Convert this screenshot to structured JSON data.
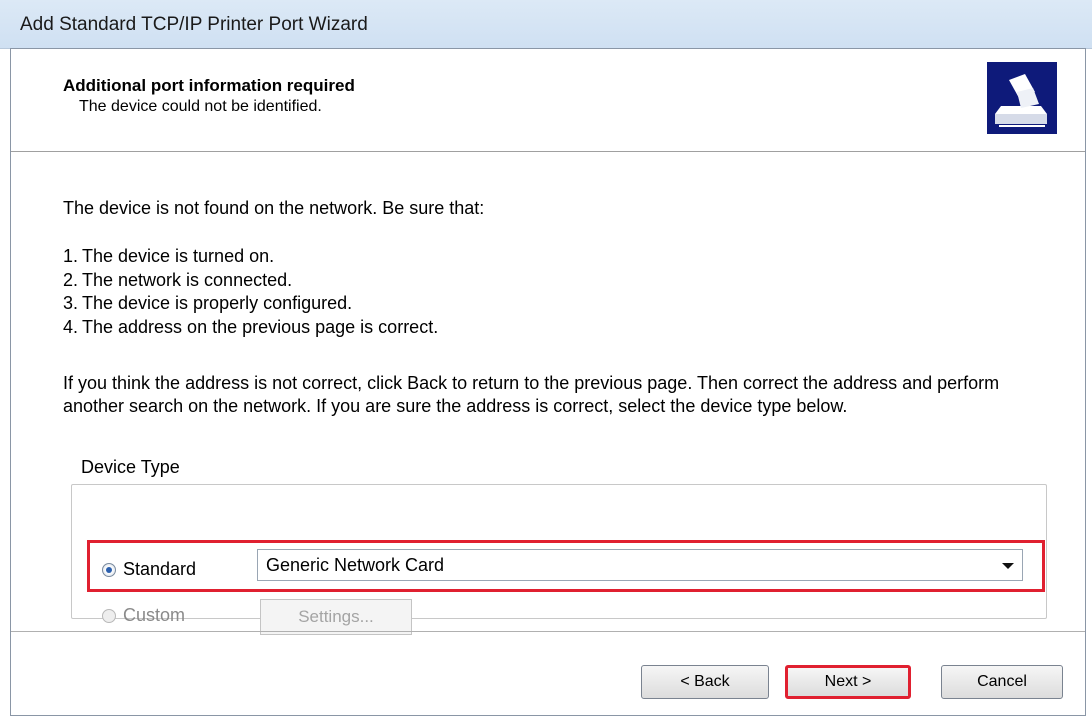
{
  "window": {
    "title": "Add Standard TCP/IP Printer Port Wizard"
  },
  "header": {
    "title": "Additional port information required",
    "subtitle": "The device could not be identified.",
    "icon": "printer-network-icon"
  },
  "content": {
    "intro": "The device is not found on the network.  Be sure that:",
    "checklist": [
      {
        "num": "1.",
        "text": "The device is turned on."
      },
      {
        "num": "2.",
        "text": "The network is connected."
      },
      {
        "num": "3.",
        "text": "The device is properly configured."
      },
      {
        "num": "4.",
        "text": "The address on the previous page is correct."
      }
    ],
    "help": "If you think the address is not correct, click Back to return to the previous page.  Then correct the address and perform another search on the network.  If you are sure the address is correct, select the device type below."
  },
  "device_type": {
    "legend": "Device Type",
    "standard_label": "Standard",
    "standard_selected": true,
    "standard_value": "Generic Network Card",
    "custom_label": "Custom",
    "settings_label": "Settings..."
  },
  "buttons": {
    "back": "< Back",
    "next": "Next >",
    "cancel": "Cancel"
  },
  "colors": {
    "highlight": "#e02030",
    "header_icon_bg": "#0e1a7a"
  }
}
